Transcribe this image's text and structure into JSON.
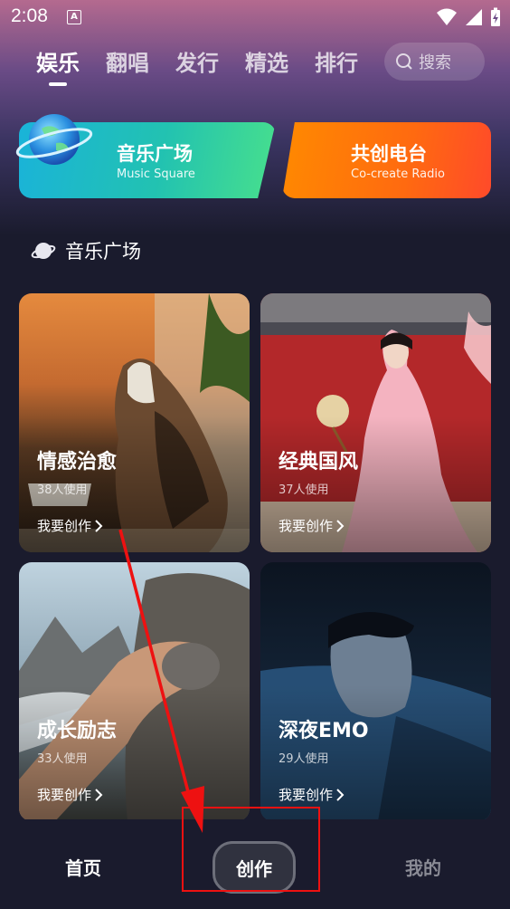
{
  "status_bar": {
    "time": "2:08",
    "icons": [
      "a-notification-icon",
      "wifi-icon",
      "signal-icon",
      "battery-icon"
    ],
    "a_glyph": "A"
  },
  "tabs": [
    {
      "label": "娱乐",
      "active": true
    },
    {
      "label": "翻唱",
      "active": false
    },
    {
      "label": "发行",
      "active": false
    },
    {
      "label": "精选",
      "active": false
    },
    {
      "label": "排行",
      "active": false
    }
  ],
  "search": {
    "placeholder": "搜索"
  },
  "banners": {
    "music": {
      "title": "音乐广场",
      "subtitle": "Music Square"
    },
    "radio": {
      "title": "共创电台",
      "subtitle": "Co-create Radio"
    }
  },
  "section": {
    "title": "音乐广场"
  },
  "cards": [
    {
      "name": "情感治愈",
      "usage": "38人使用",
      "action": "我要创作"
    },
    {
      "name": "经典国风",
      "usage": "37人使用",
      "action": "我要创作"
    },
    {
      "name": "成长励志",
      "usage": "33人使用",
      "action": "我要创作"
    },
    {
      "name": "深夜EMO",
      "usage": "29人使用",
      "action": "我要创作"
    }
  ],
  "bottom_nav": {
    "home": "首页",
    "create": "创作",
    "mine": "我的"
  },
  "colors": {
    "accent": "#ffffff",
    "annotation": "#ee1111",
    "radio": "#ff6a10",
    "music": "#22c2b1"
  }
}
